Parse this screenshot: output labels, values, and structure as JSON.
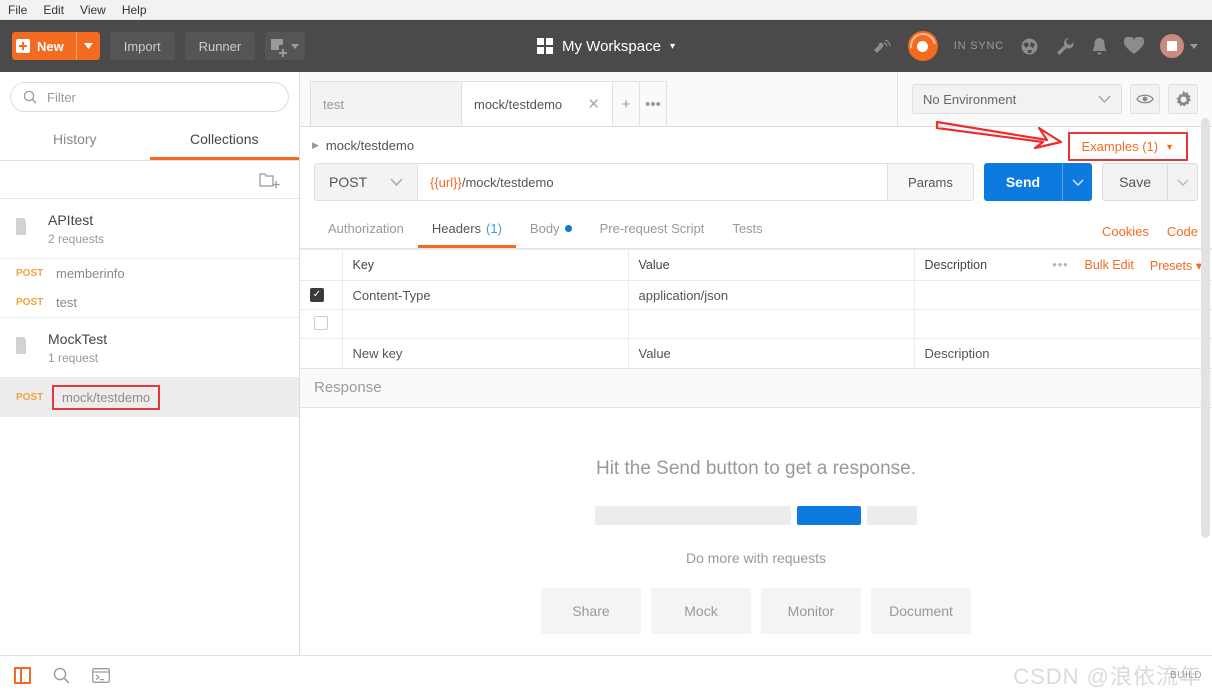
{
  "menubar": {
    "items": [
      "File",
      "Edit",
      "View",
      "Help"
    ]
  },
  "toolbar": {
    "new_label": "New",
    "import_label": "Import",
    "runner_label": "Runner",
    "new_window_icon": "new-window-icon",
    "workspace_title": "My Workspace",
    "sync_status": "IN SYNC",
    "icons": [
      "satellite-icon",
      "sync-icon",
      "globe-icon",
      "wrench-icon",
      "bell-icon",
      "heart-icon",
      "avatar-icon"
    ]
  },
  "sidebar": {
    "filter_placeholder": "Filter",
    "tabs": [
      {
        "label": "History",
        "active": false
      },
      {
        "label": "Collections",
        "active": true
      }
    ],
    "new_folder_icon": "new-folder-icon",
    "collections": [
      {
        "name": "APItest",
        "requests_count": "2 requests",
        "requests": [
          {
            "method": "POST",
            "name": "memberinfo",
            "selected": false,
            "highlighted": false
          },
          {
            "method": "POST",
            "name": "test",
            "selected": false,
            "highlighted": false
          }
        ]
      },
      {
        "name": "MockTest",
        "requests_count": "1 request",
        "requests": [
          {
            "method": "POST",
            "name": "mock/testdemo",
            "selected": true,
            "highlighted": true
          }
        ]
      }
    ]
  },
  "tabstrip": {
    "tabs": [
      {
        "label": "test",
        "active": false,
        "closable": false
      },
      {
        "label": "mock/testdemo",
        "active": true,
        "closable": true
      }
    ],
    "add_tab_label": "+",
    "more_tabs_label": "•••",
    "environment": "No Environment",
    "eye_icon": "eye-icon",
    "settings_icon": "gear-icon"
  },
  "request": {
    "breadcrumb": "mock/testdemo",
    "breadcrumb_caret": "chevron-right-icon",
    "examples_label": "Examples (1)",
    "method": "POST",
    "url_variable": "{{url}}",
    "url_path": "/mock/testdemo",
    "params_label": "Params",
    "send_label": "Send",
    "save_label": "Save",
    "tabs": [
      {
        "label": "Authorization",
        "active": false,
        "count": "",
        "dot": false
      },
      {
        "label": "Headers",
        "active": true,
        "count": "(1)",
        "dot": false
      },
      {
        "label": "Body",
        "active": false,
        "count": "",
        "dot": true
      },
      {
        "label": "Pre-request Script",
        "active": false,
        "count": "",
        "dot": false
      },
      {
        "label": "Tests",
        "active": false,
        "count": "",
        "dot": false
      }
    ],
    "right_links": [
      "Cookies",
      "Code"
    ]
  },
  "headers_table": {
    "columns": [
      "Key",
      "Value",
      "Description"
    ],
    "actions": {
      "dots": "•••",
      "bulk_edit": "Bulk Edit",
      "presets": "Presets"
    },
    "rows": [
      {
        "checked": true,
        "key": "Content-Type",
        "value": "application/json",
        "description": "",
        "placeholder_row": false
      },
      {
        "checked": false,
        "key": "",
        "value": "",
        "description": "",
        "placeholder_row": false
      },
      {
        "checked": null,
        "key": "New key",
        "value": "Value",
        "description": "Description",
        "placeholder_row": true
      }
    ]
  },
  "response": {
    "title": "Response",
    "empty_message": "Hit the Send button to get a response.",
    "do_more_label": "Do more with requests",
    "action_cards": [
      "Share",
      "Mock",
      "Monitor",
      "Document"
    ]
  },
  "footer": {
    "icons": [
      "sidebar-toggle-icon",
      "search-icon",
      "console-icon"
    ],
    "build_label": "BUILD",
    "watermark": "CSDN @浪依流年"
  },
  "colors": {
    "accent_orange": "#f26b21",
    "send_blue": "#0d7ae0",
    "annotation_red": "#e8363c",
    "dark_toolbar": "#4a4a4a"
  }
}
